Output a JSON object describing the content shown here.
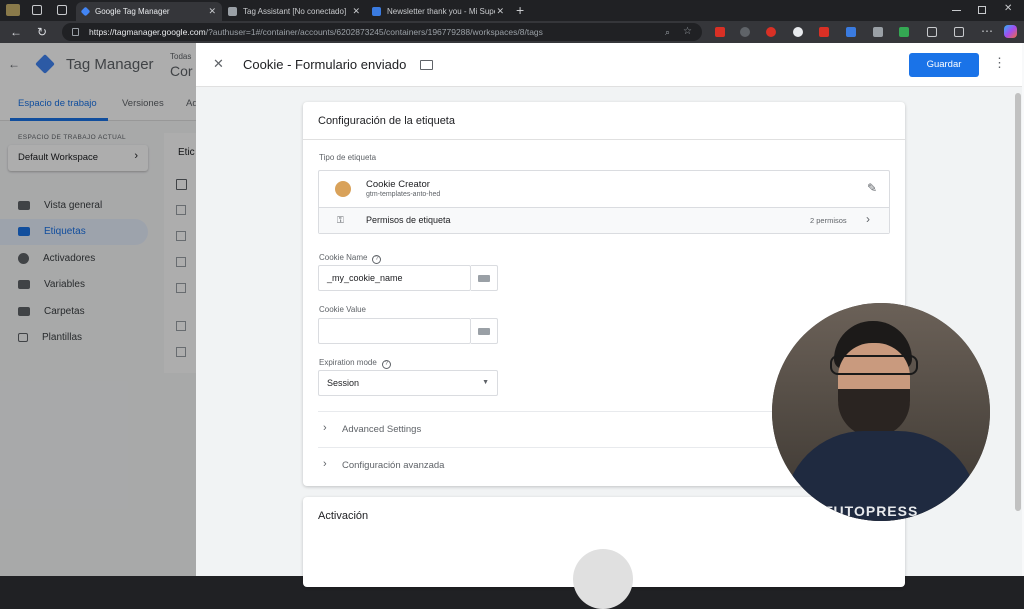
{
  "browser": {
    "tabs": [
      {
        "title": "Google Tag Manager",
        "active": true,
        "favicon_color": "#4285f4"
      },
      {
        "title": "Tag Assistant [No conectado]",
        "active": false,
        "favicon_color": "#9aa0a6"
      },
      {
        "title": "Newsletter thank you - Mi Super",
        "active": false,
        "favicon_color": "#3a7be0"
      }
    ],
    "url_host": "https://tagmanager.google.com",
    "url_path": "/?authuser=1#/container/accounts/6202873245/containers/196779288/workspaces/8/tags",
    "new_tab": "+"
  },
  "gtm": {
    "app_name": "Tag Manager",
    "accounts_label": "Todas",
    "container_initial": "Cor",
    "tabs": [
      "Espacio de trabajo",
      "Versiones",
      "Ad"
    ],
    "workspace_caption": "ESPACIO DE TRABAJO ACTUAL",
    "workspace_name": "Default Workspace",
    "nav": [
      "Vista general",
      "Etiquetas",
      "Activadores",
      "Variables",
      "Carpetas",
      "Plantillas"
    ],
    "list_title_partial": "Etic"
  },
  "panel": {
    "tag_name": "Cookie - Formulario enviado",
    "save_label": "Guardar",
    "config_title": "Configuración de la etiqueta",
    "tag_type_label": "Tipo de etiqueta",
    "template_name": "Cookie Creator",
    "template_author": "gtm-templates-anto-hed",
    "permissions_label": "Permisos de etiqueta",
    "permissions_count": "2 permisos",
    "cookie_name_label": "Cookie Name",
    "cookie_name_value": "_my_cookie_name",
    "cookie_value_label": "Cookie Value",
    "cookie_value_value": "",
    "expiration_label": "Expiration mode",
    "expiration_value": "Session",
    "advanced_settings": "Advanced Settings",
    "advanced_config": "Configuración avanzada",
    "trigger_title": "Activación"
  },
  "webcam": {
    "watermark": "TUTOPRESS"
  },
  "colors": {
    "accent": "#1a73e8",
    "nav_active_bg": "#e8f0fe"
  }
}
